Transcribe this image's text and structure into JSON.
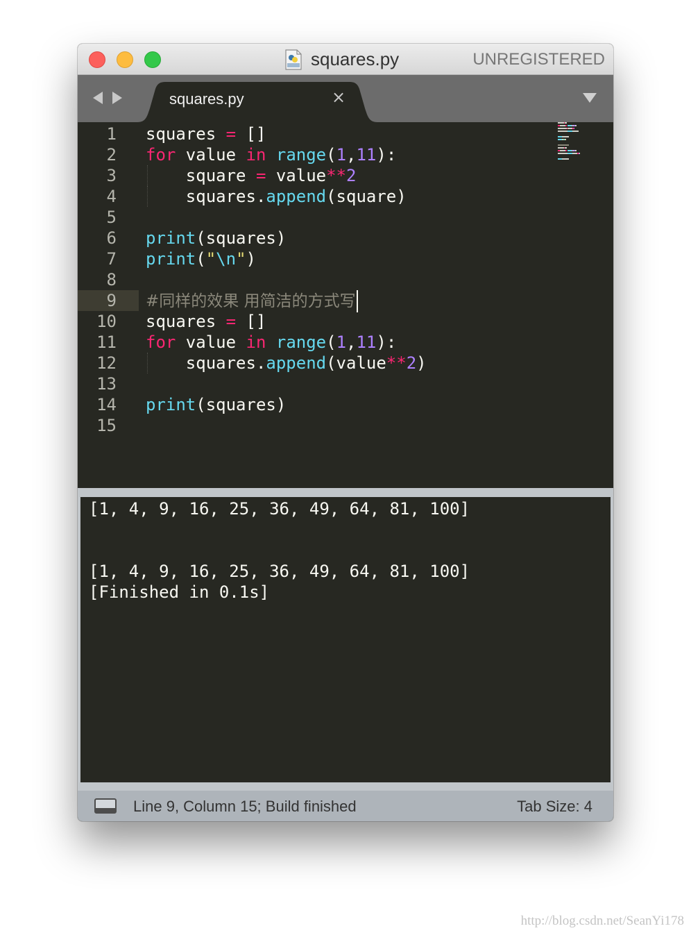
{
  "window": {
    "title": "squares.py",
    "license": "UNREGISTERED",
    "icon": "python-file-icon"
  },
  "tabs": {
    "active_label": "squares.py",
    "close_glyph": "×"
  },
  "editor": {
    "current_line": 9,
    "lines": [
      {
        "num": "1",
        "tokens": [
          {
            "t": "squares ",
            "c": ""
          },
          {
            "t": "=",
            "c": "op"
          },
          {
            "t": " []",
            "c": ""
          }
        ]
      },
      {
        "num": "2",
        "tokens": [
          {
            "t": "for",
            "c": "kw"
          },
          {
            "t": " value ",
            "c": ""
          },
          {
            "t": "in",
            "c": "kw"
          },
          {
            "t": " ",
            "c": ""
          },
          {
            "t": "range",
            "c": "fn"
          },
          {
            "t": "(",
            "c": ""
          },
          {
            "t": "1",
            "c": "num"
          },
          {
            "t": ",",
            "c": ""
          },
          {
            "t": "11",
            "c": "num"
          },
          {
            "t": "):",
            "c": ""
          }
        ]
      },
      {
        "num": "3",
        "guide": true,
        "tokens": [
          {
            "t": "    square ",
            "c": ""
          },
          {
            "t": "=",
            "c": "op"
          },
          {
            "t": " value",
            "c": ""
          },
          {
            "t": "**",
            "c": "op"
          },
          {
            "t": "2",
            "c": "num"
          }
        ]
      },
      {
        "num": "4",
        "guide": true,
        "tokens": [
          {
            "t": "    squares.",
            "c": ""
          },
          {
            "t": "append",
            "c": "fn"
          },
          {
            "t": "(square)",
            "c": ""
          }
        ]
      },
      {
        "num": "5",
        "tokens": []
      },
      {
        "num": "6",
        "tokens": [
          {
            "t": "print",
            "c": "fn"
          },
          {
            "t": "(squares)",
            "c": ""
          }
        ]
      },
      {
        "num": "7",
        "tokens": [
          {
            "t": "print",
            "c": "fn"
          },
          {
            "t": "(",
            "c": ""
          },
          {
            "t": "\"",
            "c": "str"
          },
          {
            "t": "\\n",
            "c": "fn"
          },
          {
            "t": "\"",
            "c": "str"
          },
          {
            "t": ")",
            "c": ""
          }
        ]
      },
      {
        "num": "8",
        "tokens": []
      },
      {
        "num": "9",
        "cursor": true,
        "tokens": [
          {
            "t": "#同样的效果 用简洁的方式写",
            "c": "cm"
          }
        ]
      },
      {
        "num": "10",
        "tokens": [
          {
            "t": "squares ",
            "c": ""
          },
          {
            "t": "=",
            "c": "op"
          },
          {
            "t": " []",
            "c": ""
          }
        ]
      },
      {
        "num": "11",
        "tokens": [
          {
            "t": "for",
            "c": "kw"
          },
          {
            "t": " value ",
            "c": ""
          },
          {
            "t": "in",
            "c": "kw"
          },
          {
            "t": " ",
            "c": ""
          },
          {
            "t": "range",
            "c": "fn"
          },
          {
            "t": "(",
            "c": ""
          },
          {
            "t": "1",
            "c": "num"
          },
          {
            "t": ",",
            "c": ""
          },
          {
            "t": "11",
            "c": "num"
          },
          {
            "t": "):",
            "c": ""
          }
        ]
      },
      {
        "num": "12",
        "guide": true,
        "tokens": [
          {
            "t": "    squares.",
            "c": ""
          },
          {
            "t": "append",
            "c": "fn"
          },
          {
            "t": "(value",
            "c": ""
          },
          {
            "t": "**",
            "c": "op"
          },
          {
            "t": "2",
            "c": "num"
          },
          {
            "t": ")",
            "c": ""
          }
        ]
      },
      {
        "num": "13",
        "tokens": []
      },
      {
        "num": "14",
        "tokens": [
          {
            "t": "print",
            "c": "fn"
          },
          {
            "t": "(squares)",
            "c": ""
          }
        ]
      },
      {
        "num": "15",
        "tokens": []
      }
    ]
  },
  "output": {
    "lines": [
      "[1, 4, 9, 16, 25, 36, 49, 64, 81, 100]",
      "",
      "",
      "[1, 4, 9, 16, 25, 36, 49, 64, 81, 100]",
      "[Finished in 0.1s]"
    ]
  },
  "status": {
    "text": "Line 9, Column 15; Build finished",
    "tab_size": "Tab Size: 4"
  },
  "watermark": "http://blog.csdn.net/SeanYi178",
  "colors": {
    "keyword": "#f92672",
    "function": "#66d9ef",
    "number": "#ae81ff",
    "string": "#e6db74",
    "comment": "#8a877a",
    "background": "#272822"
  }
}
